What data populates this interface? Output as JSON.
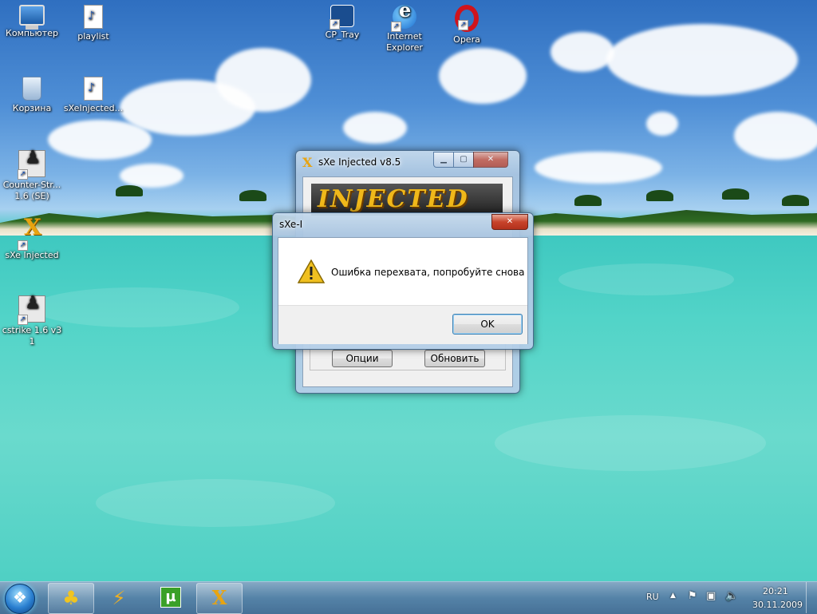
{
  "desktop": {
    "icons": [
      {
        "name": "computer",
        "label": "Компьютер",
        "kind": "computer-icon"
      },
      {
        "name": "playlist",
        "label": "playlist",
        "kind": "document-icon"
      },
      {
        "name": "recycle-bin",
        "label": "Корзина",
        "kind": "recycle-bin-icon"
      },
      {
        "name": "sxeinjected-folder",
        "label": "sXeInjected...",
        "kind": "sxe-setup-icon"
      },
      {
        "name": "counter-strike-se",
        "label": "Counter-Str...\n1.6 (SE)",
        "kind": "counter-strike-icon"
      },
      {
        "name": "sxe-injected",
        "label": "sXe Injected",
        "kind": "sxe-icon"
      },
      {
        "name": "cstrike",
        "label": "cstrike 1.6 v31",
        "kind": "counter-strike-icon"
      },
      {
        "name": "cp-tray",
        "label": "CP_Tray",
        "kind": "cp-tray-icon"
      },
      {
        "name": "internet-explorer",
        "label": "Internet\nExplorer",
        "kind": "internet-explorer-icon"
      },
      {
        "name": "opera",
        "label": "Opera",
        "kind": "opera-icon"
      }
    ]
  },
  "main_window": {
    "title": "sXe Injected v8.5",
    "banner_text": "INJECTED",
    "buttons": {
      "options": "Опции",
      "update": "Обновить"
    },
    "caption": {
      "minimize": "▁",
      "maximize": "▢",
      "close": "✕"
    }
  },
  "dialog": {
    "title": "sXe-I",
    "message": "Ошибка перехвата, попробуйте снова",
    "ok_label": "OK",
    "close_glyph": "✕",
    "icon": "warning-icon"
  },
  "taskbar": {
    "pinned": [
      {
        "name": "app-yellow",
        "icon": "game-icon"
      },
      {
        "name": "winamp",
        "icon": "winamp-icon"
      },
      {
        "name": "utorrent",
        "icon": "utorrent-icon"
      },
      {
        "name": "sxe-injected",
        "icon": "sxe-icon"
      }
    ],
    "tray": {
      "language": "RU",
      "time": "20:21",
      "date": "30.11.2009",
      "icons": [
        "show-hidden-icon",
        "action-center-icon",
        "network-icon",
        "volume-icon"
      ]
    }
  },
  "colors": {
    "warning": "#f0c020",
    "close_button": "#c7432b",
    "sxe_accent": "#e8a410"
  }
}
